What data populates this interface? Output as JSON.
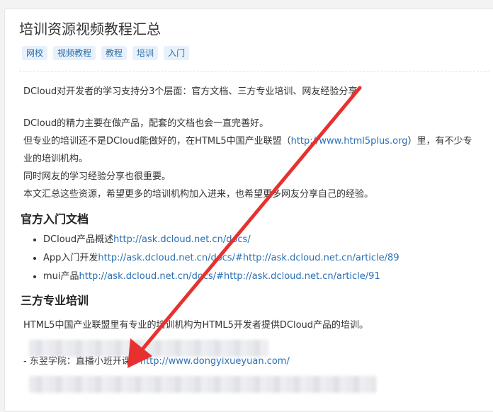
{
  "title": "培训资源视频教程汇总",
  "tags": [
    "网校",
    "视频教程",
    "教程",
    "培训",
    "入门"
  ],
  "intro": "DCloud对开发者的学习支持分3个层面：官方文档、三方专业培训、网友经验分享",
  "p1": "DCloud的精力主要在做产品，配套的文档也会一直完善好。",
  "p2_prefix": "但专业的培训还不是DCloud能做好的，在HTML5中国产业联盟（",
  "p2_link": "http://www.html5plus.org",
  "p2_suffix": "）里，有不少专",
  "p2_line2": "业的培训机构。",
  "p3": "同时网友的学习经验分享也很重要。",
  "p4": "本文汇总这些资源，希望更多的培训机构加入进来，也希望更多网友分享自己的经验。",
  "section1": {
    "heading": "官方入门文档",
    "items": [
      {
        "label": "DCloud产品概述",
        "link": "http://ask.dcloud.net.cn/docs/"
      },
      {
        "label": "App入门开发",
        "link": "http://ask.dcloud.net.cn/docs/#http://ask.dcloud.net.cn/article/89"
      },
      {
        "label": "mui产品",
        "link": "http://ask.dcloud.net.cn/docs/#http://ask.dcloud.net.cn/article/91"
      }
    ]
  },
  "section2": {
    "heading": "三方专业培训",
    "intro": "HTML5中国产业联盟里有专业的培训机构为HTML5开发者提供DCloud产品的培训。",
    "entry_label": "- 东翌学院：直播小班开课：",
    "entry_link": "http://www.dongyixueyuan.com/"
  },
  "colors": {
    "arrow": "#e8312f",
    "link": "#2a6fb4",
    "tag_bg": "#e8f1fb"
  }
}
